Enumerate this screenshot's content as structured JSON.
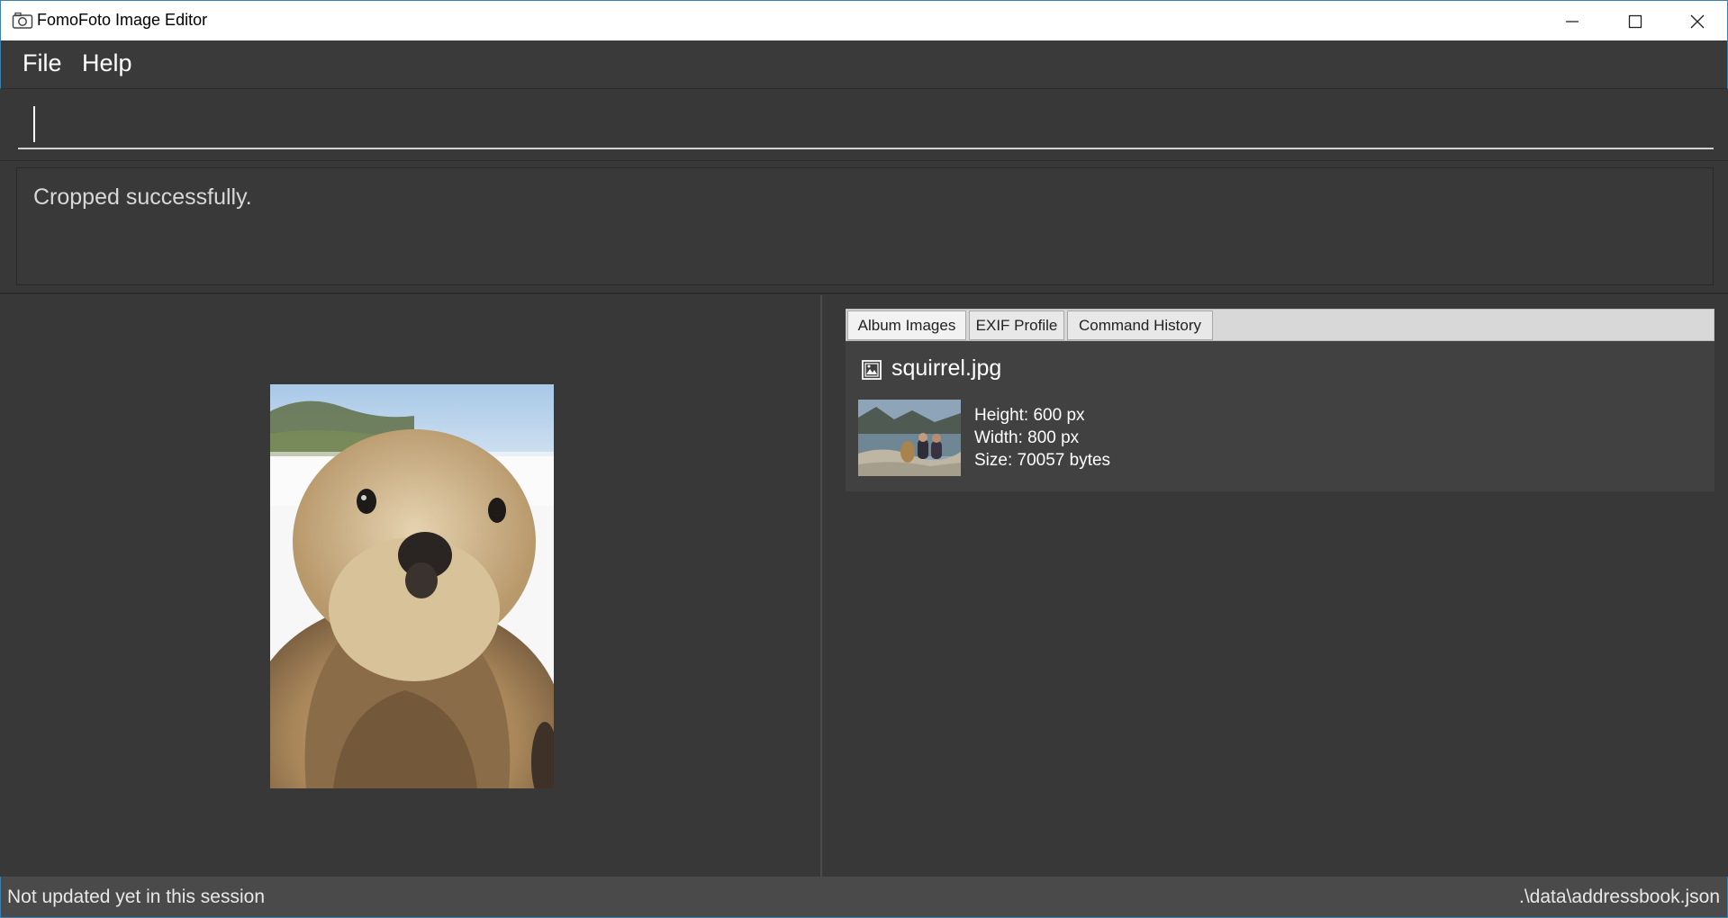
{
  "window": {
    "title": "FomoFoto Image Editor",
    "icon": "camera-icon"
  },
  "menu": {
    "items": [
      {
        "label": "File"
      },
      {
        "label": "Help"
      }
    ]
  },
  "command": {
    "value": "",
    "placeholder": ""
  },
  "result": {
    "message": "Cropped successfully."
  },
  "tabs": [
    {
      "label": "Album Images",
      "selected": true
    },
    {
      "label": "EXIF Profile",
      "selected": false
    },
    {
      "label": "Command History",
      "selected": false
    }
  ],
  "album": {
    "items": [
      {
        "icon": "image-file-icon",
        "name": "squirrel.jpg",
        "height": "Height: 600 px",
        "width": "Width: 800 px",
        "size": "Size: 70057 bytes"
      }
    ]
  },
  "status": {
    "left": "Not updated yet in this session",
    "right": ".\\data\\addressbook.json"
  },
  "colors": {
    "background": "#3a3a3a",
    "status_bar": "#4a4a4a",
    "window_border": "#3c7fb1"
  }
}
